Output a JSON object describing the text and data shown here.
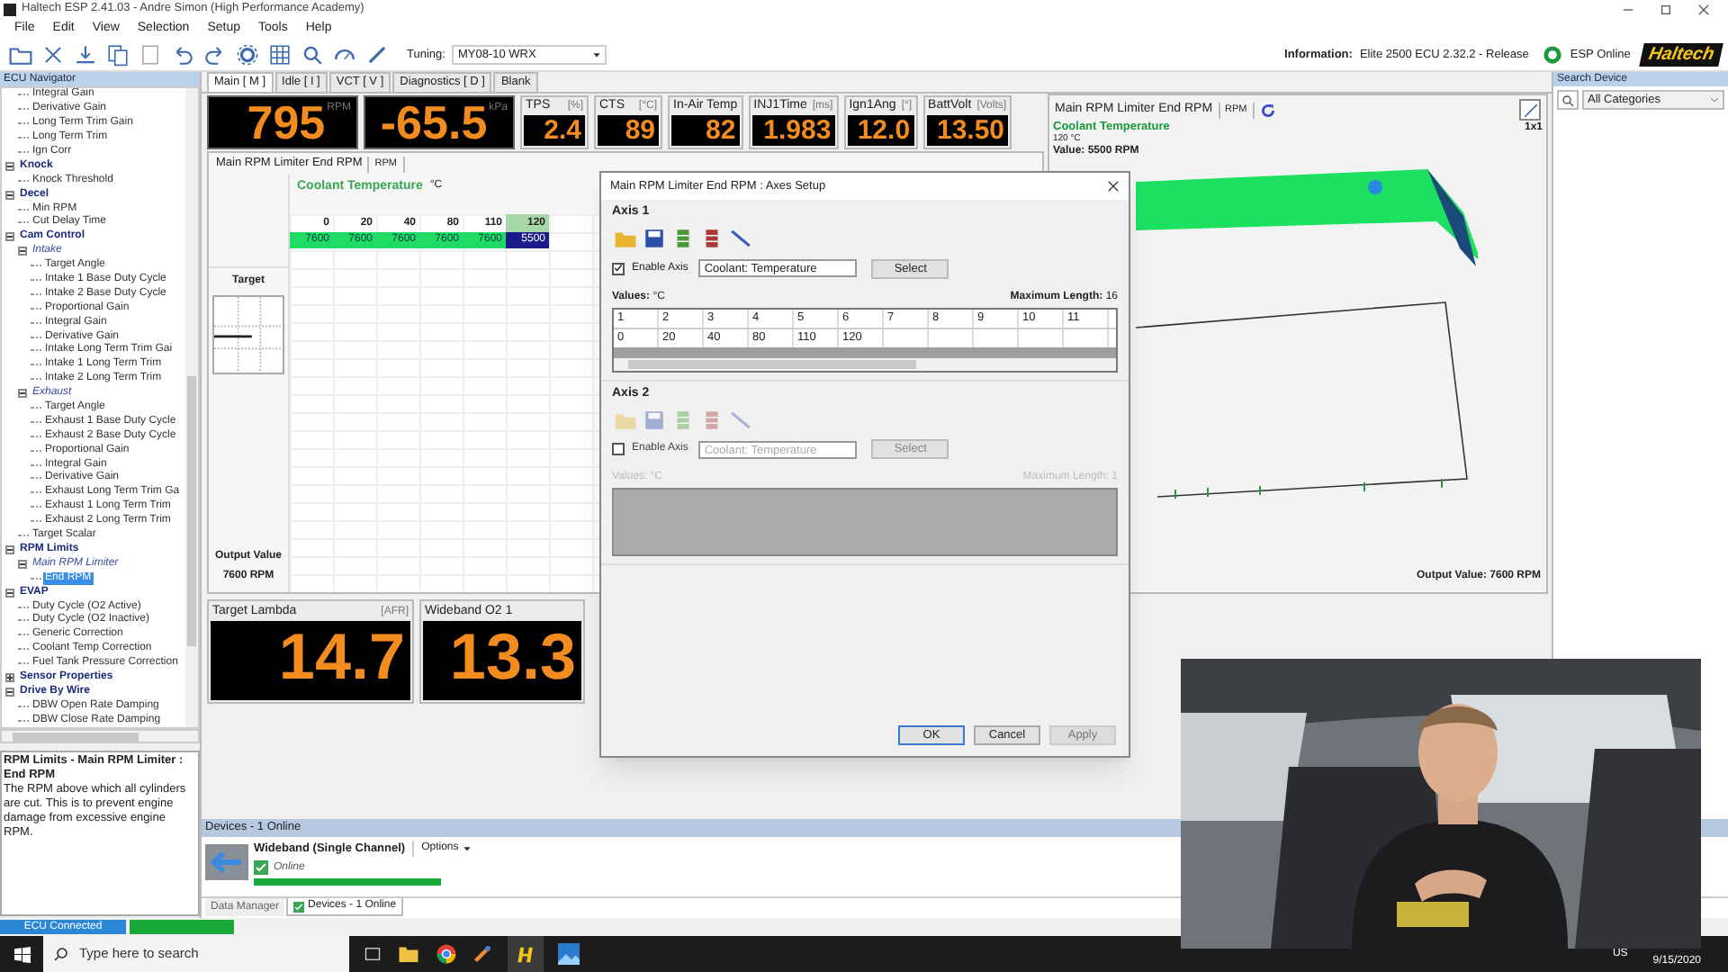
{
  "window": {
    "title": "Haltech ESP 2.41.03 - Andre Simon (High Performance Academy)"
  },
  "menu": [
    "File",
    "Edit",
    "View",
    "Selection",
    "Setup",
    "Tools",
    "Help"
  ],
  "toolbar": {
    "tuning_label": "Tuning:",
    "tuning_value": "MY08-10 WRX",
    "information_label": "Information:",
    "information_value": "Elite 2500 ECU 2.32.2 - Release",
    "status": "ESP Online",
    "logo": "Haltech"
  },
  "navigator": {
    "title": "ECU Navigator",
    "leading_items": [
      {
        "label": "Integral Gain",
        "selected": false
      },
      {
        "label": "Derivative Gain",
        "selected": false
      },
      {
        "label": "Long Term Trim Gain",
        "selected": false
      },
      {
        "label": "Long Term Trim",
        "selected": false
      },
      {
        "label": "Ign Corr",
        "selected": false
      }
    ],
    "tree": [
      {
        "label": "Knock",
        "kind": "group",
        "expanded": true,
        "selected": false,
        "children": [
          {
            "label": "Knock Threshold",
            "kind": "item",
            "selected": false
          }
        ]
      },
      {
        "label": "Decel",
        "kind": "group",
        "expanded": true,
        "selected": false,
        "children": [
          {
            "label": "Min RPM",
            "kind": "item",
            "selected": false
          },
          {
            "label": "Cut Delay Time",
            "kind": "item",
            "selected": false
          }
        ]
      },
      {
        "label": "Cam Control",
        "kind": "group",
        "expanded": true,
        "selected": false,
        "children": [
          {
            "label": "Intake",
            "kind": "subgroup",
            "expanded": true,
            "selected": false,
            "children": [
              {
                "label": "Target Angle",
                "kind": "item",
                "selected": false
              },
              {
                "label": "Intake 1 Base Duty Cycle",
                "kind": "item",
                "selected": false
              },
              {
                "label": "Intake 2 Base Duty Cycle",
                "kind": "item",
                "selected": false
              },
              {
                "label": "Proportional Gain",
                "kind": "item",
                "selected": false
              },
              {
                "label": "Integral Gain",
                "kind": "item",
                "selected": false
              },
              {
                "label": "Derivative Gain",
                "kind": "item",
                "selected": false
              },
              {
                "label": "Intake Long Term Trim Gai",
                "kind": "item",
                "selected": false
              },
              {
                "label": "Intake 1 Long Term Trim",
                "kind": "item",
                "selected": false
              },
              {
                "label": "Intake 2 Long Term Trim",
                "kind": "item",
                "selected": false
              }
            ]
          },
          {
            "label": "Exhaust",
            "kind": "subgroup",
            "expanded": true,
            "selected": false,
            "children": [
              {
                "label": "Target Angle",
                "kind": "item",
                "selected": false
              },
              {
                "label": "Exhaust 1 Base Duty Cycle",
                "kind": "item",
                "selected": false
              },
              {
                "label": "Exhaust 2 Base Duty Cycle",
                "kind": "item",
                "selected": false
              },
              {
                "label": "Proportional Gain",
                "kind": "item",
                "selected": false
              },
              {
                "label": "Integral Gain",
                "kind": "item",
                "selected": false
              },
              {
                "label": "Derivative Gain",
                "kind": "item",
                "selected": false
              },
              {
                "label": "Exhaust Long Term Trim Ga",
                "kind": "item",
                "selected": false
              },
              {
                "label": "Exhaust 1 Long Term Trim",
                "kind": "item",
                "selected": false
              },
              {
                "label": "Exhaust 2 Long Term Trim",
                "kind": "item",
                "selected": false
              }
            ]
          },
          {
            "label": "Target Scalar",
            "kind": "item",
            "selected": false
          }
        ]
      },
      {
        "label": "RPM Limits",
        "kind": "group",
        "expanded": true,
        "selected": false,
        "children": [
          {
            "label": "Main RPM Limiter",
            "kind": "subgroup",
            "expanded": true,
            "selected": false,
            "children": [
              {
                "label": "End RPM",
                "kind": "item",
                "selected": true
              }
            ]
          }
        ]
      },
      {
        "label": "EVAP",
        "kind": "group",
        "expanded": true,
        "selected": false,
        "children": [
          {
            "label": "Duty Cycle (O2 Active)",
            "kind": "item",
            "selected": false
          },
          {
            "label": "Duty Cycle (O2 Inactive)",
            "kind": "item",
            "selected": false
          },
          {
            "label": "Generic Correction",
            "kind": "item",
            "selected": false
          },
          {
            "label": "Coolant Temp Correction",
            "kind": "item",
            "selected": false
          },
          {
            "label": "Fuel Tank Pressure Correction",
            "kind": "item",
            "selected": false
          }
        ]
      },
      {
        "label": "Sensor Properties",
        "kind": "group",
        "expanded": false,
        "selected": false
      },
      {
        "label": "Drive By Wire",
        "kind": "group",
        "expanded": true,
        "selected": false,
        "children": [
          {
            "label": "DBW Open Rate Damping",
            "kind": "item",
            "selected": false
          },
          {
            "label": "DBW Close Rate Damping",
            "kind": "item",
            "selected": false
          }
        ]
      }
    ]
  },
  "description": {
    "title": "RPM Limits - Main RPM Limiter : End RPM",
    "text": "The RPM above which all cylinders are cut. This is to prevent engine damage from excessive engine RPM."
  },
  "page_tabs": [
    {
      "label": "Main [ M ]",
      "selected": true
    },
    {
      "label": "Idle [ I ]",
      "selected": false
    },
    {
      "label": "VCT [ V ]",
      "selected": false
    },
    {
      "label": "Diagnostics [ D ]",
      "selected": false
    },
    {
      "label": "Blank",
      "selected": false
    }
  ],
  "gauges": [
    {
      "kind": "large",
      "unit": "RPM",
      "value": "795"
    },
    {
      "kind": "large",
      "unit": "kPa",
      "value": "-65.5"
    },
    {
      "kind": "small",
      "label": "TPS",
      "unit": "[%]",
      "value": "2.4"
    },
    {
      "kind": "small",
      "label": "CTS",
      "unit": "[°C]",
      "value": "89"
    },
    {
      "kind": "small",
      "label": "In-Air Temp",
      "value": "82"
    },
    {
      "kind": "small",
      "label": "INJ1Time",
      "unit": "[ms]",
      "value": "1.983"
    },
    {
      "kind": "small",
      "label": "Ign1Ang",
      "unit": "[°]",
      "value": "12.0"
    },
    {
      "kind": "small",
      "label": "BattVolt",
      "unit": "[Volts]",
      "value": "13.50"
    }
  ],
  "table_panel": {
    "tabs": [
      "Main RPM Limiter End RPM",
      "RPM"
    ],
    "axis_name": "Coolant Temperature",
    "axis_unit": "°C",
    "columns": [
      {
        "label": "0",
        "value": "7600",
        "selected": false
      },
      {
        "label": "20",
        "value": "7600",
        "selected": false
      },
      {
        "label": "40",
        "value": "7600",
        "selected": false
      },
      {
        "label": "80",
        "value": "7600",
        "selected": false
      },
      {
        "label": "110",
        "value": "7600",
        "selected": false
      },
      {
        "label": "120",
        "value": "5500",
        "selected": true
      }
    ],
    "side_label": "Target",
    "output_label": "Output Value",
    "output_value": "7600 RPM"
  },
  "lower_gauges": [
    {
      "label": "Target Lambda",
      "unit": "[AFR]",
      "value": "14.7"
    },
    {
      "label": "Wideband O2 1",
      "value": "13.3"
    }
  ],
  "surface_panel": {
    "tabs": [
      "Main RPM Limiter End RPM",
      "RPM"
    ],
    "zoom": "1x1",
    "axis_name": "Coolant Temperature",
    "axis_value": "120 °C",
    "value": "Value: 5500 RPM",
    "output": "Output Value: 7600 RPM"
  },
  "search_device": {
    "title": "Search Device",
    "category": "All Categories"
  },
  "devices": {
    "title": "Devices - 1 Online",
    "device": {
      "name": "Wideband (Single Channel)",
      "options": "Options",
      "status": "Online",
      "level": 1
    },
    "tabs": [
      {
        "label": "Data Manager",
        "selected": false
      },
      {
        "label": "Devices - 1 Online",
        "selected": true
      }
    ]
  },
  "status_bar": {
    "connection": "ECU Connected",
    "level": 1
  },
  "taskbar": {
    "search_placeholder": "Type here to search",
    "language": "US",
    "date": "9/15/2020"
  },
  "dialog": {
    "title": "Main RPM Limiter End RPM : Axes Setup",
    "axes": [
      {
        "title": "Axis 1",
        "enabled": true,
        "enable_label": "Enable Axis",
        "source": "Coolant: Temperature",
        "select": "Select",
        "values_label": "Values:",
        "unit": "°C",
        "max_label": "Maximum Length:",
        "max_value": "16",
        "column_numbers": [
          "1",
          "2",
          "3",
          "4",
          "5",
          "6",
          "7",
          "8",
          "9",
          "10",
          "11"
        ],
        "values": [
          "0",
          "20",
          "40",
          "80",
          "110",
          "120"
        ]
      },
      {
        "title": "Axis 2",
        "enabled": false,
        "enable_label": "Enable Axis",
        "source": "Coolant: Temperature",
        "select": "Select",
        "values_label": "Values:",
        "unit": "°C",
        "max_label": "Maximum Length:",
        "max_value": "1"
      }
    ],
    "buttons": [
      {
        "label": "OK",
        "disabled": false
      },
      {
        "label": "Cancel",
        "disabled": false
      },
      {
        "label": "Apply",
        "disabled": true
      }
    ]
  },
  "webcam": {
    "kind": "picture"
  }
}
